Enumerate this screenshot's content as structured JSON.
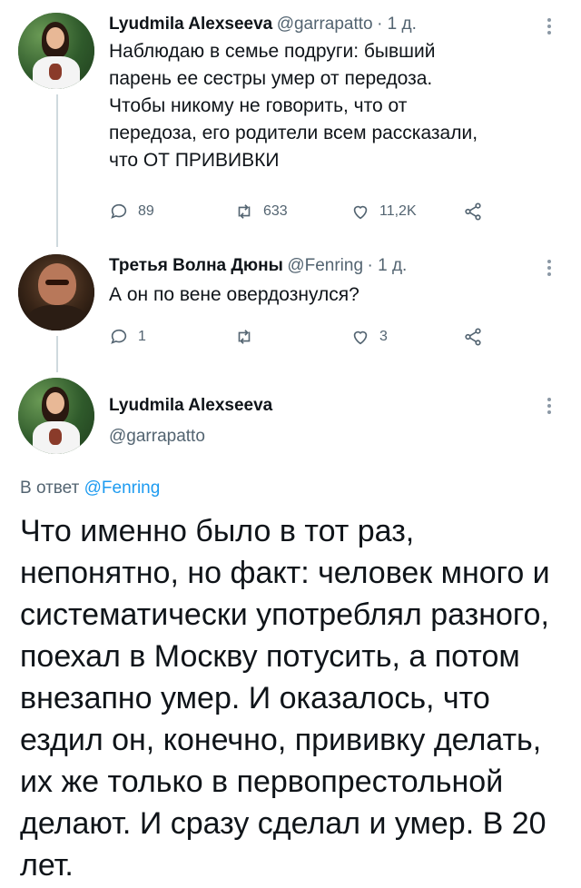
{
  "tweets": [
    {
      "author": "Lyudmila Alexseeva",
      "handle": "@garrapatto",
      "time": "1 д.",
      "text": "Наблюдаю в семье подруги: бывший\nпарень ее сестры умер от передоза.\nЧтобы никому не говорить, что от\nпередоза, его родители всем рассказали,\nчто ОТ ПРИВИВКИ",
      "replies": "89",
      "retweets": "633",
      "likes": "11,2K"
    },
    {
      "author": "Третья Волна Дюны",
      "handle": "@Fenring",
      "time": "1 д.",
      "text": "А он по вене овердознулся?",
      "replies": "1",
      "retweets": "",
      "likes": "3"
    }
  ],
  "main_tweet": {
    "author": "Lyudmila Alexseeva",
    "handle": "@garrapatto",
    "reply_prefix": "В ответ ",
    "reply_to": "@Fenring",
    "text": "Что именно было в тот раз, непонятно, но факт: человек много и систематически употреблял разного, поехал в Москву потусить, а потом внезапно умер. И оказалось, что ездил он, конечно, прививку делать, их же только в первопрестольной делают. И сразу сделал и умер. В 20 лет."
  },
  "colors": {
    "link": "#1d9bf0",
    "secondary_text": "#536471",
    "thread_line": "#cfd9de"
  }
}
